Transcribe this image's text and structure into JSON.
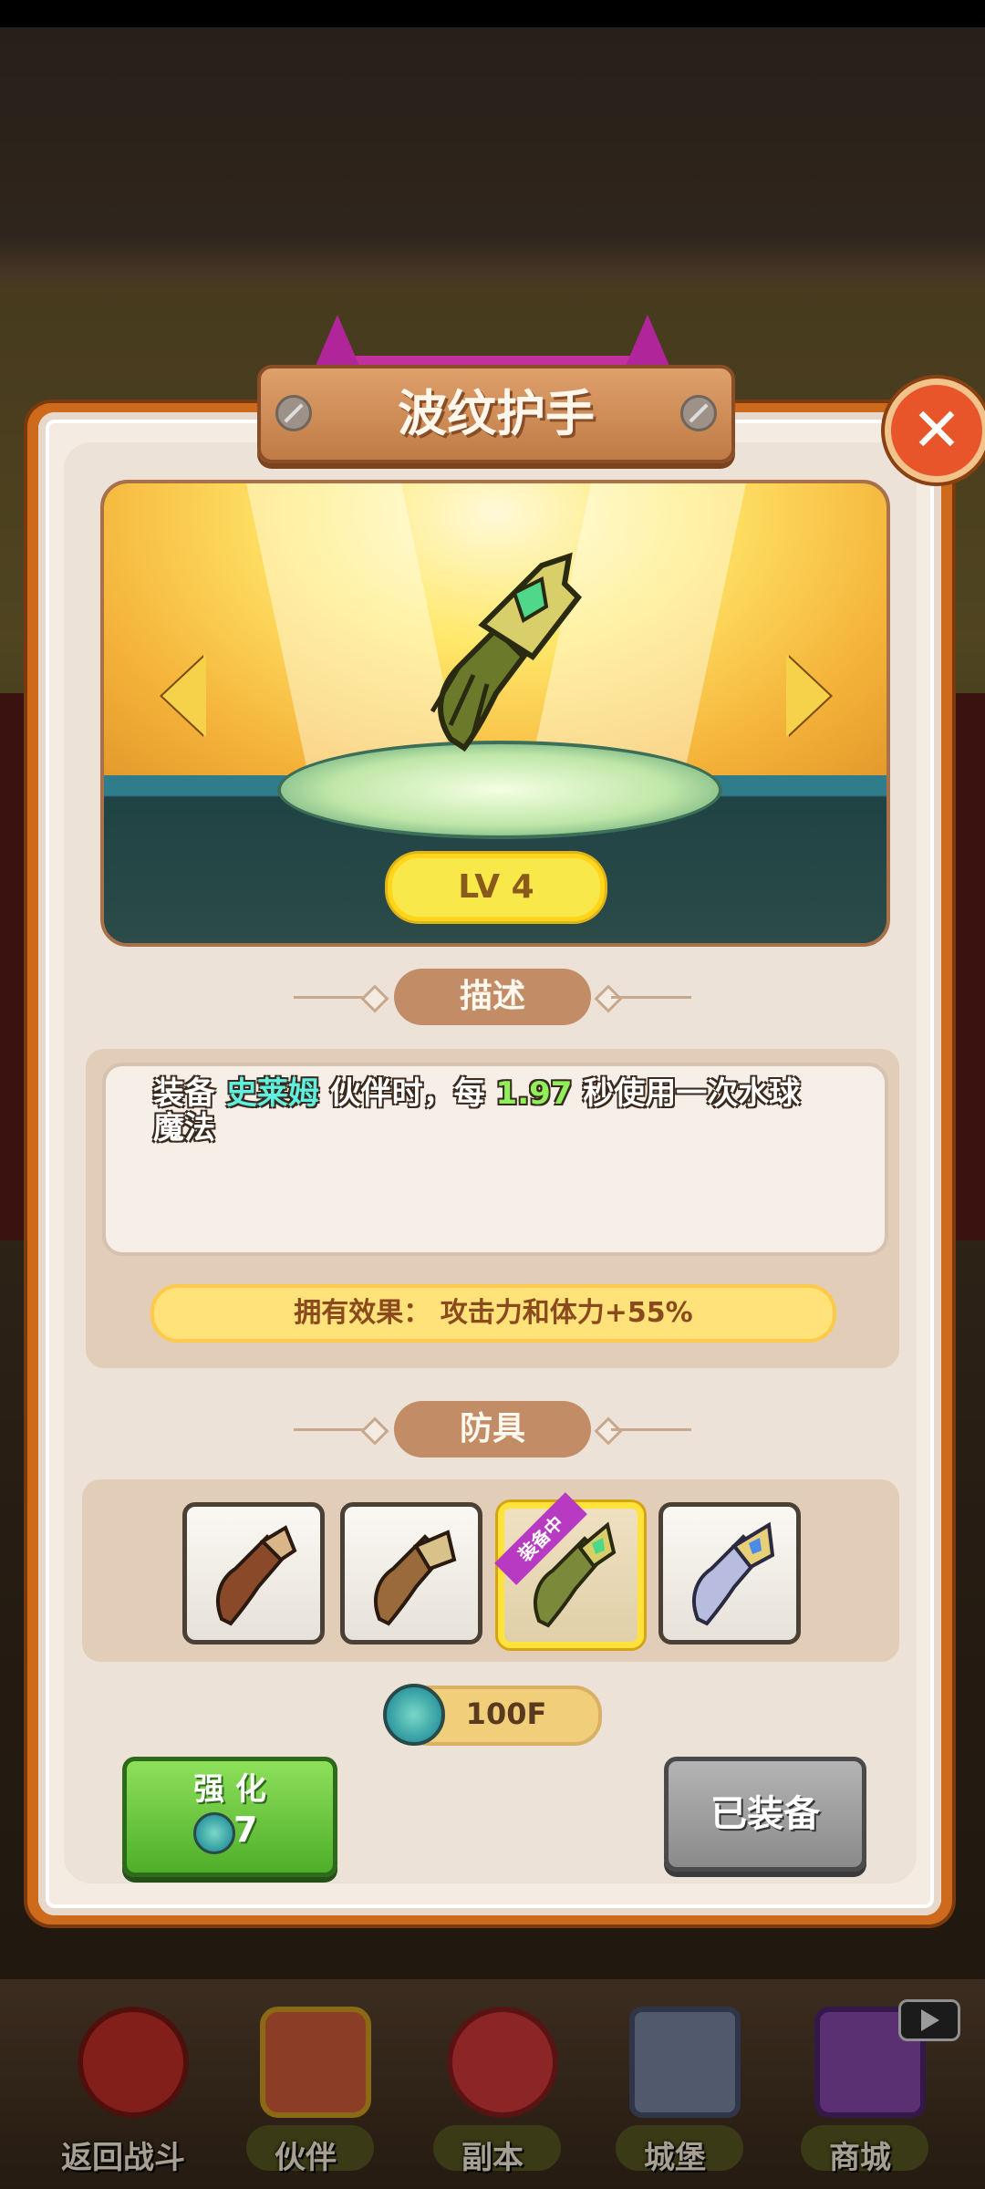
{
  "dialog": {
    "title": "波纹护手",
    "close_label": "✕",
    "level": "LV 4",
    "description_header": "描述",
    "description": {
      "part1": "装备 ",
      "partner": "史莱姆",
      "part2": " 伙伴时，每 ",
      "interval": "1.97",
      "part3": " 秒使用一次水球魔法"
    },
    "effect": "拥有效果： 攻击力和体力+55%",
    "armor_header": "防具",
    "armor_slots": [
      {
        "name": "leather-gauntlet",
        "selected": false
      },
      {
        "name": "bronze-gauntlet",
        "selected": false
      },
      {
        "name": "ripple-gauntlet",
        "selected": true,
        "tag": "装备中"
      },
      {
        "name": "crystal-gauntlet",
        "selected": false
      }
    ],
    "cost": "100F",
    "enhance_label": "强 化",
    "enhance_cost": "7",
    "equipped_label": "已装备"
  },
  "nav": {
    "items": [
      {
        "label": "返回战斗"
      },
      {
        "label": "伙伴"
      },
      {
        "label": "副本"
      },
      {
        "label": "城堡"
      },
      {
        "label": "商城"
      }
    ]
  },
  "colors": {
    "accent_orange": "#cd6a1b",
    "highlight_cyan": "#5ff0e0",
    "highlight_green": "#8ff05a",
    "level_yellow": "#f8e84a",
    "enhance_green": "#4fae2a"
  }
}
